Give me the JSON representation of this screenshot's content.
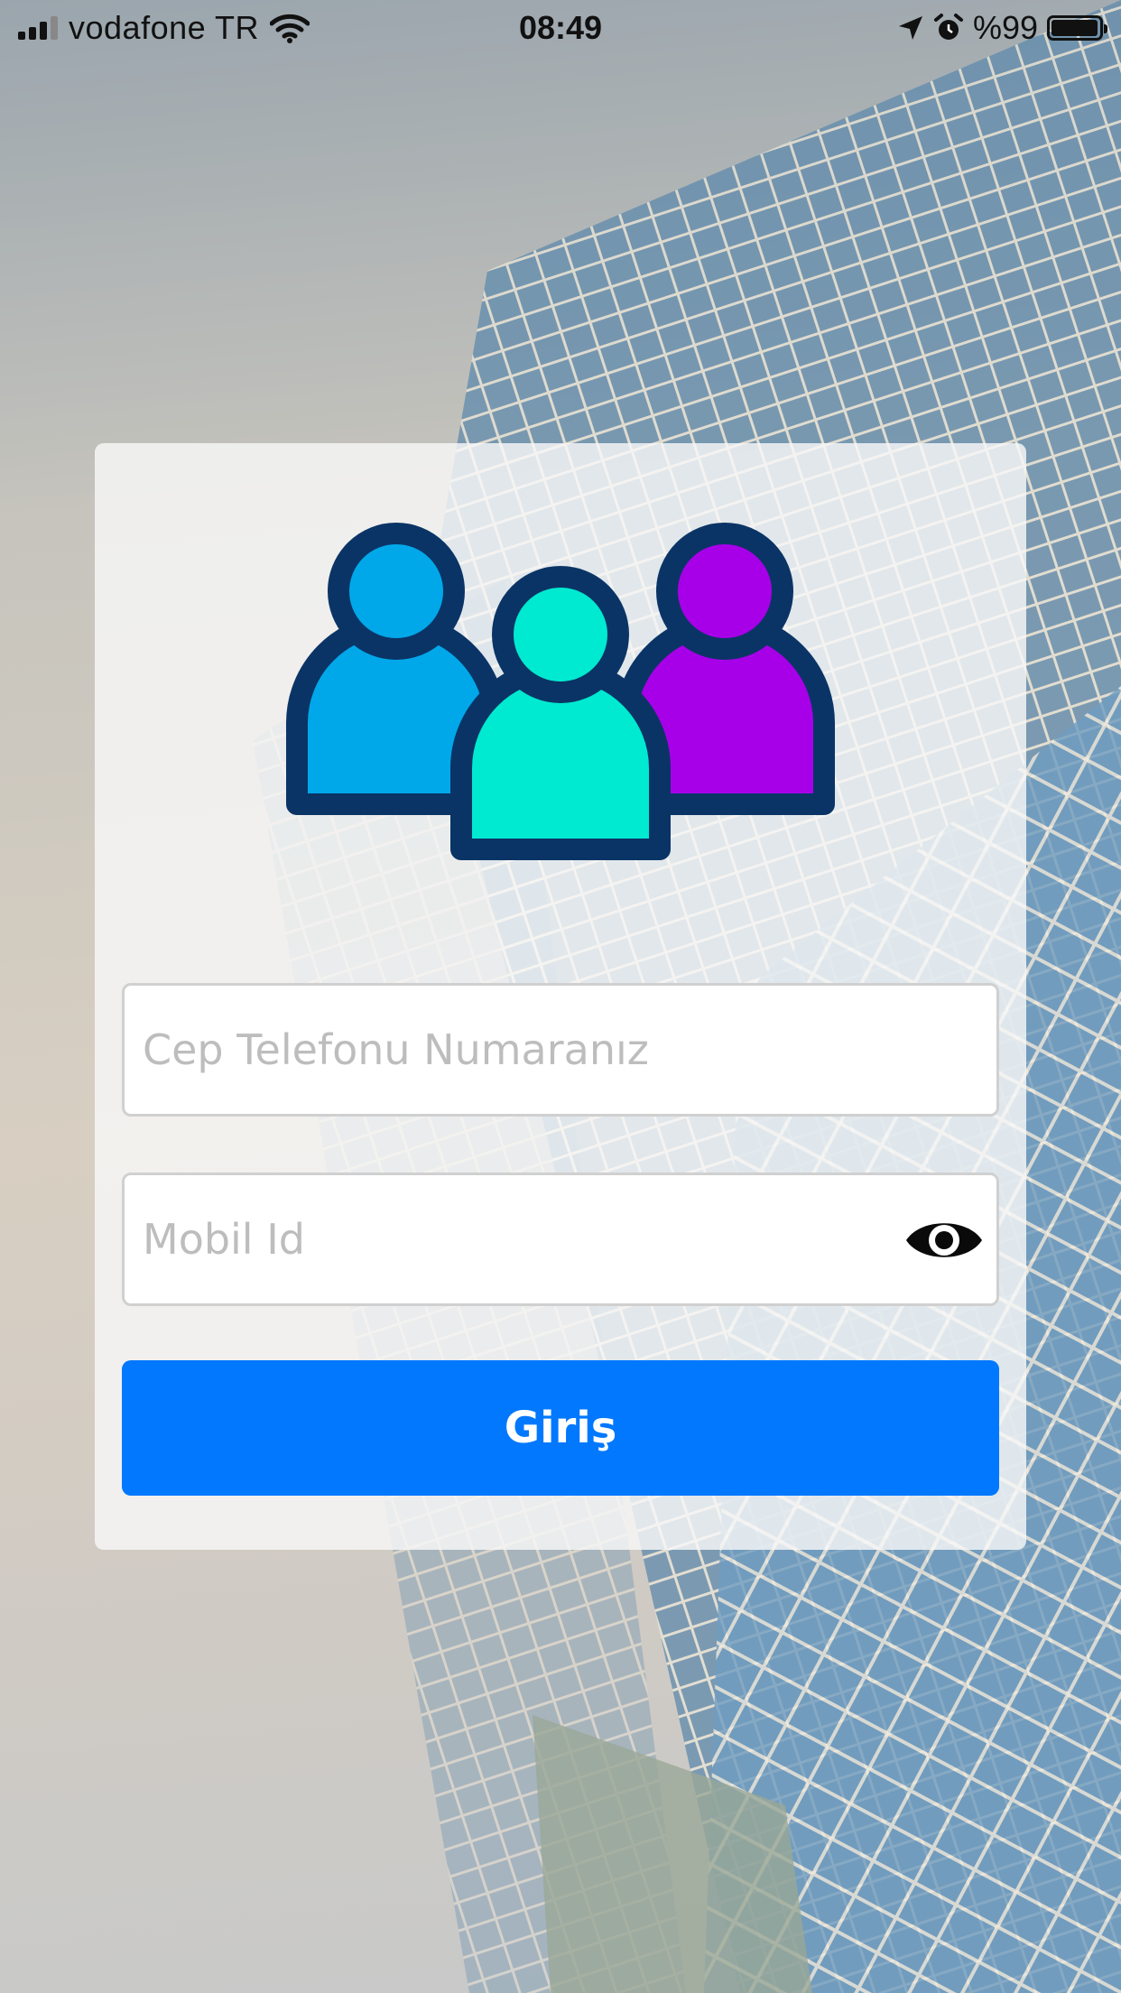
{
  "status_bar": {
    "carrier": "vodafone TR",
    "time": "08:49",
    "battery": "%99",
    "battery_level": 0.99,
    "icons": [
      "signal-icon",
      "wifi-icon",
      "location-icon",
      "alarm-icon",
      "battery-icon"
    ]
  },
  "login": {
    "logo_icon": "users-group-icon",
    "phone_placeholder": "Cep Telefonu Numaranız",
    "phone_value": "",
    "mobil_id_placeholder": "Mobil Id",
    "mobil_id_value": "",
    "toggle_icon": "eye-icon",
    "submit_label": "Giriş"
  },
  "colors": {
    "button": "#0178fe",
    "logo_outline": "#0b3466",
    "logo_left": "#00a8ea",
    "logo_middle": "#00ead1",
    "logo_right": "#a700e8"
  }
}
